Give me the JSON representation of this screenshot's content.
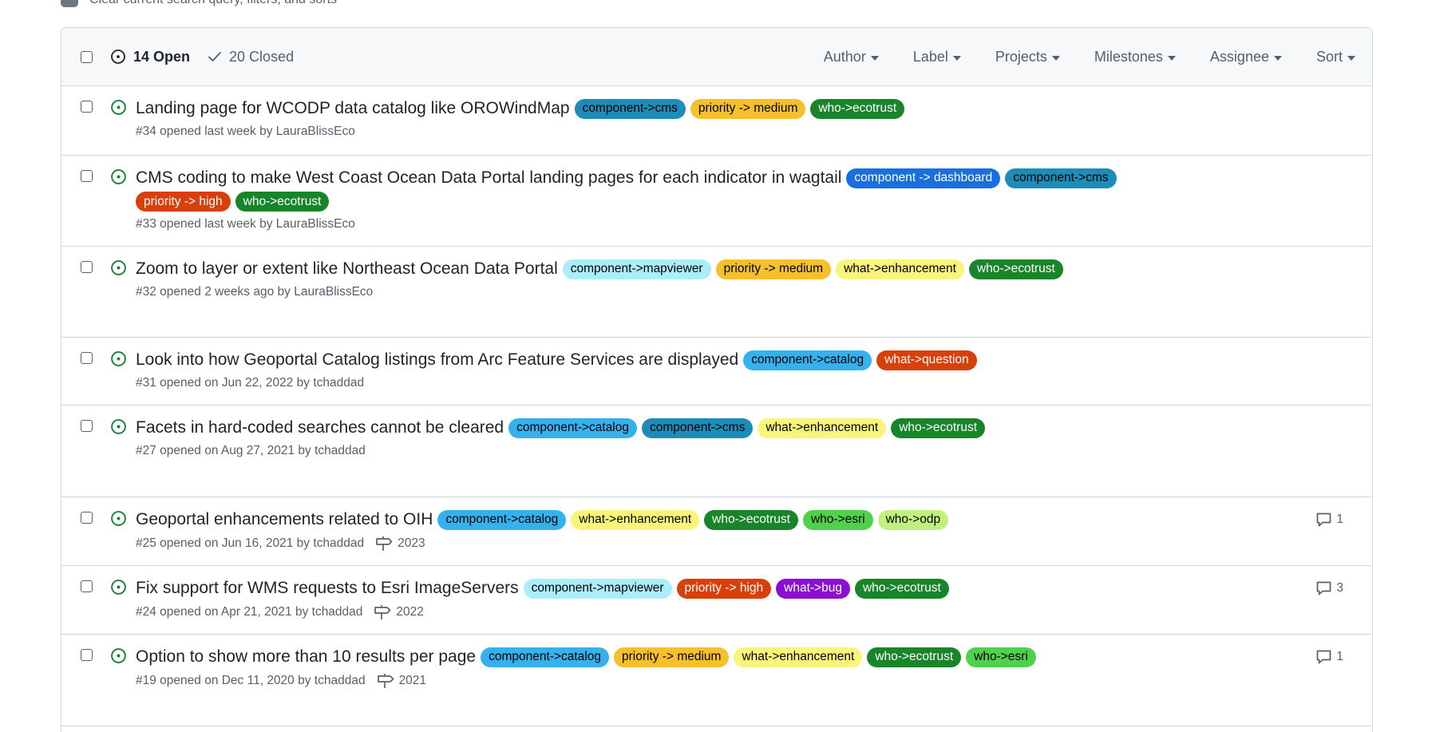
{
  "top_bar": {
    "clear_label": "Clear current search query, filters, and sorts"
  },
  "header": {
    "open_label": "14 Open",
    "closed_label": "20 Closed",
    "filters": [
      "Author",
      "Label",
      "Projects",
      "Milestones",
      "Assignee",
      "Sort"
    ]
  },
  "label_colors": {
    "component->cms": [
      "#1d8cb8",
      "#000000"
    ],
    "component -> dashboard": [
      "#1a6fde",
      "#ffffff"
    ],
    "component->catalog": [
      "#35b2ee",
      "#000000"
    ],
    "component->mapviewer": [
      "#a9eefa",
      "#000000"
    ],
    "priority -> medium": [
      "#f6c02c",
      "#000000"
    ],
    "priority -> high": [
      "#d93f0b",
      "#ffffff"
    ],
    "who->ecotrust": [
      "#18852b",
      "#ffffff"
    ],
    "who->esri": [
      "#4fd14b",
      "#000000"
    ],
    "who->odp": [
      "#c2f07e",
      "#000000"
    ],
    "what->enhancement": [
      "#fbf47a",
      "#000000"
    ],
    "what->question": [
      "#d93f0b",
      "#ffffff"
    ],
    "what->bug": [
      "#8a0fd2",
      "#ffffff"
    ]
  },
  "issues": [
    {
      "title": "Landing page for WCODP data catalog like OROWindMap",
      "labels": [
        "component->cms",
        "priority -> medium",
        "who->ecotrust"
      ],
      "meta": "#34 opened last week by LauraBlissEco",
      "milestone": "",
      "comments": ""
    },
    {
      "title": "CMS coding to make West Coast Ocean Data Portal landing pages for each indicator in wagtail",
      "labels": [
        "component -> dashboard",
        "component->cms",
        "priority -> high",
        "who->ecotrust"
      ],
      "meta": "#33 opened last week by LauraBlissEco",
      "milestone": "",
      "comments": ""
    },
    {
      "title": "Zoom to layer or extent like Northeast Ocean Data Portal",
      "labels": [
        "component->mapviewer",
        "priority -> medium",
        "what->enhancement",
        "who->ecotrust"
      ],
      "meta": "#32 opened 2 weeks ago by LauraBlissEco",
      "milestone": "",
      "comments": ""
    },
    {
      "title": "Look into how Geoportal Catalog listings from Arc Feature Services are displayed",
      "labels": [
        "component->catalog",
        "what->question"
      ],
      "meta": "#31 opened on Jun 22, 2022 by tchaddad",
      "milestone": "",
      "comments": ""
    },
    {
      "title": "Facets in hard-coded searches cannot be cleared",
      "labels": [
        "component->catalog",
        "component->cms",
        "what->enhancement",
        "who->ecotrust"
      ],
      "meta": "#27 opened on Aug 27, 2021 by tchaddad",
      "milestone": "",
      "comments": ""
    },
    {
      "title": "Geoportal enhancements related to OIH",
      "labels": [
        "component->catalog",
        "what->enhancement",
        "who->ecotrust",
        "who->esri",
        "who->odp"
      ],
      "meta": "#25 opened on Jun 16, 2021 by tchaddad",
      "milestone": "2023",
      "comments": "1"
    },
    {
      "title": "Fix support for WMS requests to Esri ImageServers",
      "labels": [
        "component->mapviewer",
        "priority -> high",
        "what->bug",
        "who->ecotrust"
      ],
      "meta": "#24 opened on Apr 21, 2021 by tchaddad",
      "milestone": "2022",
      "comments": "3"
    },
    {
      "title": "Option to show more than 10 results per page",
      "labels": [
        "component->catalog",
        "priority -> medium",
        "what->enhancement",
        "who->ecotrust",
        "who->esri"
      ],
      "meta": "#19 opened on Dec 11, 2020 by tchaddad",
      "milestone": "2021",
      "comments": "1"
    }
  ]
}
